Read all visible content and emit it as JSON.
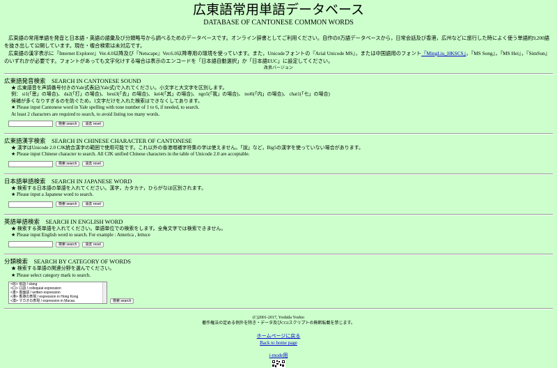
{
  "header": {
    "title": "広東語常用単語データベース",
    "subtitle": "DATABASE OF CANTONESE COMMON WORDS"
  },
  "intro": {
    "p1": "広東語の常用単語を発音と日本語・英語の語彙及び分類略号から調べるためのデータベースです。オンライン辞書としてご利用ください。自作の8万語データベースから，日常会話及び香港，広州などに旅行した時によく使う単語約9,200語を抜き出して公開しています。現在・複合検索は未対応です。",
    "p2a": "広東語の漢字表示に『Internet Explorer』Ver.4.0以降及び『Netscape』Ver.6.0以降専用の環境を使っています。また，Unicodeフォントの『Arial Unicode MS』，または中国語用のフォント",
    "p2_link": "『MingLiu_HKSCS』",
    "p2b": "，『MS Song』，『MS Hei』，『SimSun』のいずれかが必要です。フォントがあっても文字化けする場合は表示のエンコードを「日本語自動選択」か「日本語EUC」に設定してください。",
    "revision": "改良バージョン"
  },
  "sections": {
    "sound": {
      "title": "広東語発音検索　SEARCH IN CANTONESE SOUND",
      "l1": "★ 広東語音を声調番号付きのYale式表記(Yale式)で入れてください。小文字と大文字を区別します。",
      "l2": "例： si1(「思」の場合)、 da2(「打」の場合)、 heui3(「去」の場合)、 kei4(「其」の場合)、 ngo5(「我」の場合)、 noi6(「内」の場合)、 chat1(「七」の場合)",
      "l3": "候補が多くなりすぎるのを防ぐため，1文字だけを入れた検索はできなくしてあります。",
      "l4": "★ Please input Cantonese word in Yale spelling with tone number of 1 to 6, if needed, to search.",
      "l5": "At least 2 characters are required to search, to avoid listing too many words.",
      "search": "検索 search",
      "reset": "消去 reset"
    },
    "character": {
      "title": "広東語漢字検索　SEARCH IN CHINESE CHARACTER OF CANTONESE",
      "l1": "★ 漢字はUnicode 2.0 CJK統合漢字の範囲で使用可能です。これ以外の香港増補字符集の字は使えません。「說」など，Big5の漢字を使っていない場合があります。",
      "l2": "★ Please input Chinese character to search. All CJK unified Chinese characters in the table of Unicode 2.0 are acceptable.",
      "search": "検索 search",
      "reset": "消去 reset"
    },
    "japanese": {
      "title": "日本語単語検索　SEARCH IN JAPANESE WORD",
      "l1": "★ 検索する日本語の単語を入れてください。漢字，カタカナ，ひらがなは区別されます。",
      "l2": "★ Please input a Japanese word to search.",
      "search": "検索 search",
      "reset": "消去 reset"
    },
    "english": {
      "title": "英語単語検索　SEARCH IN ENGLISH WORD",
      "l1": "★ 検索する英単語を入れてください。単語単位での検索をします。全角文字では検索できません。",
      "l2": "★ Please input English word to search. For example : America , lettuce",
      "search": "検索 search",
      "reset": "消去 reset"
    },
    "category": {
      "title": "分類検索　SEARCH BY CATEGORY OF WORDS",
      "l1": "★ 検索する単語の関連分野を選んでください。",
      "l2": "★ Please select category mark to search.",
      "options": [
        "<俗> 俗語 / slang",
        "<口> 口語 / colloquial expression",
        "<書> 書面語 / written expression",
        "<港> 香港の表現 / expression in Hong Kong",
        "<澳> マカオの表現 / expression in Macau"
      ],
      "search": "検索 search"
    }
  },
  "footer": {
    "copyright": "(C)2001-2017, Yoshida Yoshio",
    "notice": "著作権法の定める例外を除き・データ及びCGIスクリプトの無断転載を禁じます。",
    "home_jp": "ホームページに戻る",
    "home_en": "Back to home page",
    "imode": "i-mode用"
  }
}
